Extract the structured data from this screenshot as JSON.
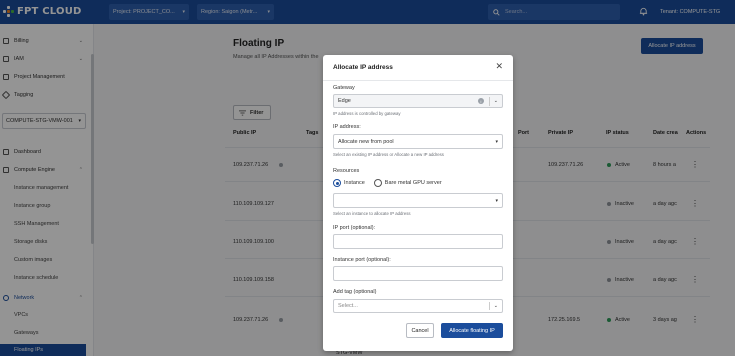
{
  "brand": {
    "name": "FPT CLOUD"
  },
  "topbar": {
    "project_select": "Project: PROJECT_CO...",
    "region_select": "Region: Saigon (Metr...",
    "search_placeholder": "Search...",
    "tenant": "Tenant: COMPUTE-STG"
  },
  "sidebar": {
    "top_items": [
      {
        "label": "Billing"
      },
      {
        "label": "IAM"
      },
      {
        "label": "Project Management"
      },
      {
        "label": "Tagging"
      }
    ],
    "project_select": "COMPUTE-STG-VMW-001",
    "dashboard": "Dashboard",
    "compute_engine": "Compute Engine",
    "compute_items": [
      "Instance management",
      "Instance group",
      "SSH Management",
      "Storage disks",
      "Custom images",
      "Instance schedule"
    ],
    "network": "Network",
    "network_items": [
      "VPCs",
      "Gateways"
    ],
    "active_item": "Floating IPs"
  },
  "page": {
    "title": "Floating IP",
    "subtitle": "Manage all IP Addresses within the",
    "allocate_button": "Allocate IP address",
    "filter_label": "Filter"
  },
  "table": {
    "headers": {
      "public_ip": "Public IP",
      "tags": "Tags",
      "port": "Port",
      "private_ip": "Private IP",
      "ip_status": "IP status",
      "date": "Date crea",
      "actions": "Actions"
    },
    "rows": [
      {
        "public_ip": "109.237.71.26",
        "private_ip": "109.237.71.26",
        "status": "Active",
        "date": "8 hours a"
      },
      {
        "public_ip": "110.109.109.127",
        "private_ip": "",
        "status": "Inactive",
        "date": "a day agc"
      },
      {
        "public_ip": "110.109.109.100",
        "private_ip": "",
        "status": "Inactive",
        "date": "a day agc"
      },
      {
        "public_ip": "110.109.109.158",
        "private_ip": "",
        "status": "Inactive",
        "date": "a day agc"
      },
      {
        "public_ip": "109.237.71.26",
        "private_ip": "172.25.169.5",
        "status": "Active",
        "date": "3 days ag"
      }
    ],
    "footer_text": "STG-VMW"
  },
  "modal": {
    "title": "Allocate IP address",
    "gateway_label": "Gateway",
    "gateway_value": "Edge",
    "gateway_hint": "IP address is controlled by gateway",
    "ip_label": "IP address:",
    "ip_value": "Allocate new from pool",
    "ip_hint": "Select an existing IP address or Allocate a new IP address",
    "resources_label": "Resources",
    "radio_instance": "Instance",
    "radio_baremetal": "Bare metal GPU server",
    "instance_hint": "Select an instance to allocate IP address",
    "ip_port_label": "IP port (optional):",
    "instance_port_label": "Instance port (optional):",
    "tag_label": "Add tag (optional)",
    "tag_placeholder": "Select...",
    "cancel": "Cancel",
    "submit": "Allocate floating IP"
  },
  "colors": {
    "brand": "#1b4d9c",
    "active": "#2e9b5a",
    "inactive": "#8f959c"
  }
}
